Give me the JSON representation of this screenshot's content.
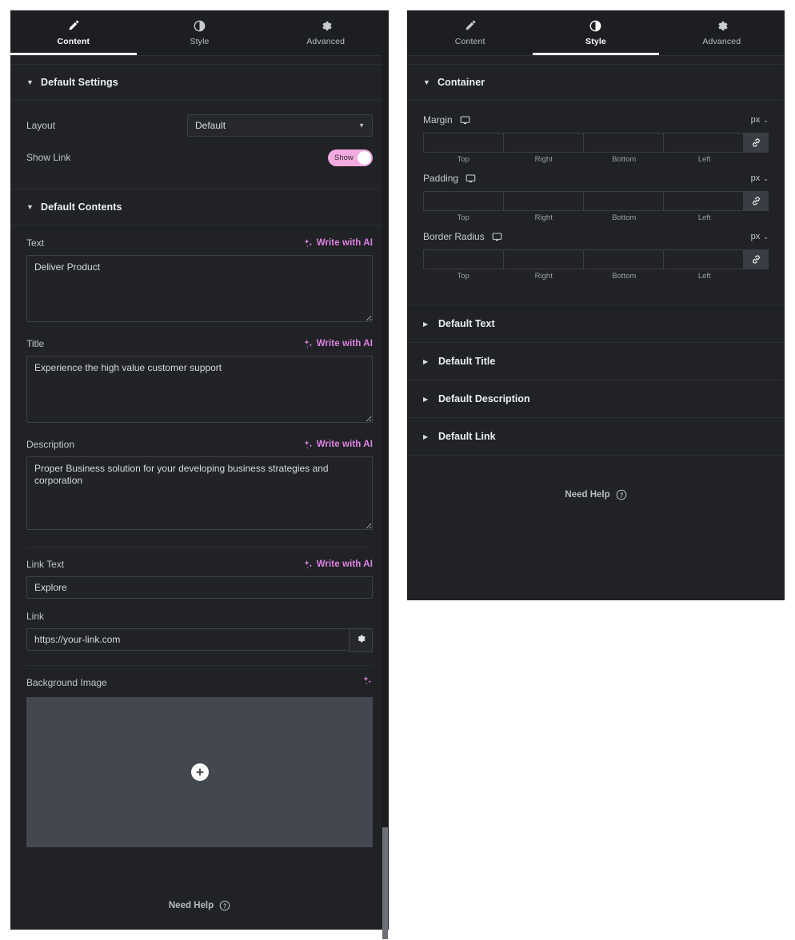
{
  "tabs": [
    {
      "id": "content",
      "label": "Content",
      "icon": "pencil-icon",
      "active_left": true,
      "active_right": false
    },
    {
      "id": "style",
      "label": "Style",
      "icon": "contrast-icon",
      "active_left": false,
      "active_right": true
    },
    {
      "id": "advanced",
      "label": "Advanced",
      "icon": "gear-icon",
      "active_left": false,
      "active_right": false
    }
  ],
  "colors": {
    "panel_bg": "#202225",
    "tabbar_bg": "#1c1e21",
    "accent_ai": "#de82e4",
    "toggle_on": "#f2aadf",
    "image_placeholder": "#434850",
    "border": "#3d4045"
  },
  "left_panel": {
    "default_settings": {
      "title": "Default Settings",
      "caret": "▼",
      "layout": {
        "label": "Layout",
        "value": "Default",
        "options": [
          "Default"
        ]
      },
      "show_link": {
        "label": "Show Link",
        "toggle_text": "Show",
        "state": "on"
      }
    },
    "default_contents": {
      "title": "Default Contents",
      "caret": "▼",
      "ai_label": "Write with AI",
      "fields": {
        "text": {
          "label": "Text",
          "value": "Deliver Product"
        },
        "title": {
          "label": "Title",
          "value": "Experience the high value customer support"
        },
        "description": {
          "label": "Description",
          "value": "Proper Business solution for your developing business strategies and corporation"
        },
        "link_text": {
          "label": "Link Text",
          "value": "Explore"
        },
        "link": {
          "label": "Link",
          "value": "https://your-link.com"
        },
        "background_image": {
          "label": "Background Image"
        }
      }
    },
    "need_help": "Need Help"
  },
  "right_panel": {
    "container": {
      "title": "Container",
      "caret": "▼",
      "unit": "px",
      "unit_caret": "⌄",
      "captions": [
        "Top",
        "Right",
        "Bottom",
        "Left"
      ],
      "controls": [
        {
          "label": "Margin",
          "device": "desktop-icon",
          "unit": "px",
          "values": [
            "",
            "",
            "",
            ""
          ],
          "linked": true
        },
        {
          "label": "Padding",
          "device": "desktop-icon",
          "unit": "px",
          "values": [
            "",
            "",
            "",
            ""
          ],
          "linked": true
        },
        {
          "label": "Border Radius",
          "device": "desktop-icon",
          "unit": "px",
          "values": [
            "",
            "",
            "",
            ""
          ],
          "linked": true
        }
      ]
    },
    "sections": [
      {
        "title": "Default Text",
        "caret": "▶",
        "expanded": false
      },
      {
        "title": "Default Title",
        "caret": "▶",
        "expanded": false
      },
      {
        "title": "Default Description",
        "caret": "▶",
        "expanded": false
      },
      {
        "title": "Default Link",
        "caret": "▶",
        "expanded": false
      }
    ],
    "need_help": "Need Help"
  }
}
